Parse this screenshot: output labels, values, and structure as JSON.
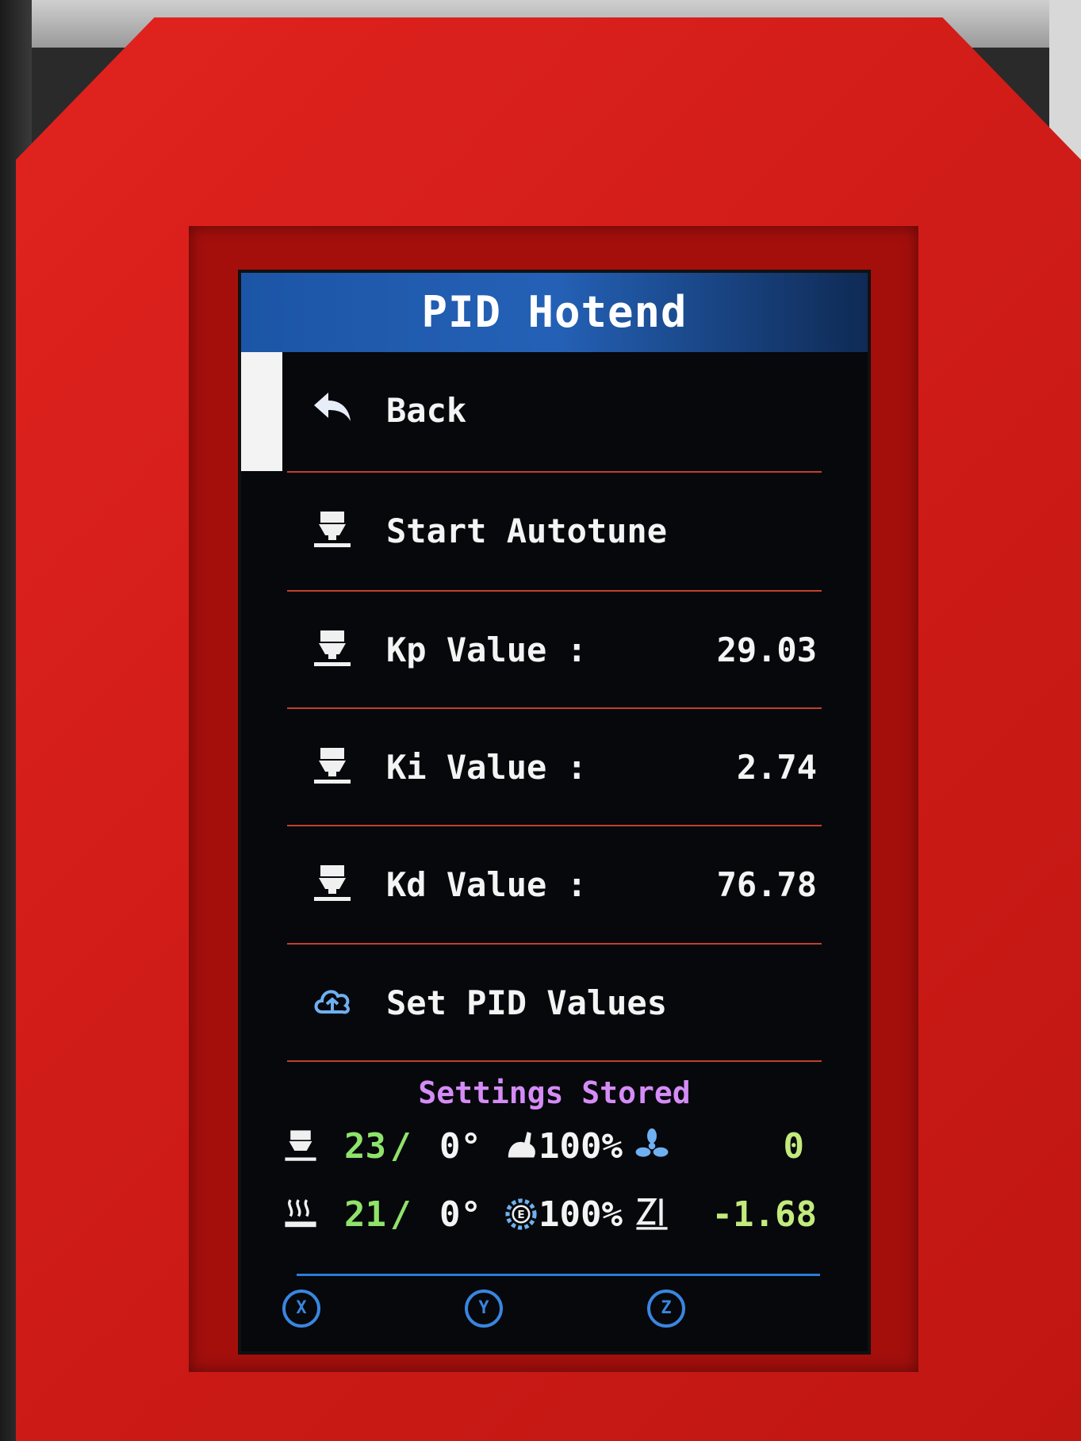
{
  "header": {
    "title": "PID Hotend"
  },
  "menu": [
    {
      "label": "Back",
      "value": "",
      "icon": "back-arrow-icon"
    },
    {
      "label": "Start Autotune",
      "value": "",
      "icon": "hotend-icon"
    },
    {
      "label": "Kp Value :",
      "value": "29.03",
      "icon": "hotend-icon"
    },
    {
      "label": "Ki Value :",
      "value": "2.74",
      "icon": "hotend-icon"
    },
    {
      "label": "Kd Value :",
      "value": "76.78",
      "icon": "hotend-icon"
    },
    {
      "label": "Set PID Values",
      "value": "",
      "icon": "cloud-save-icon"
    }
  ],
  "status_message": "Settings Stored",
  "status": {
    "hotend_current": "23",
    "hotend_target": "0°",
    "speed": "100%",
    "fan": "0",
    "bed_current": "21",
    "bed_target": "0°",
    "flow": "100%",
    "z_offset": "-1.68"
  },
  "axis_buttons": [
    "X",
    "Y",
    "Z"
  ],
  "colors": {
    "header": "#2461b6",
    "divider": "#c1402c",
    "status_message": "#d58cf6",
    "temp_current": "#8fe36a",
    "accent_blue": "#3a86e0",
    "case_red": "#d01c18"
  }
}
